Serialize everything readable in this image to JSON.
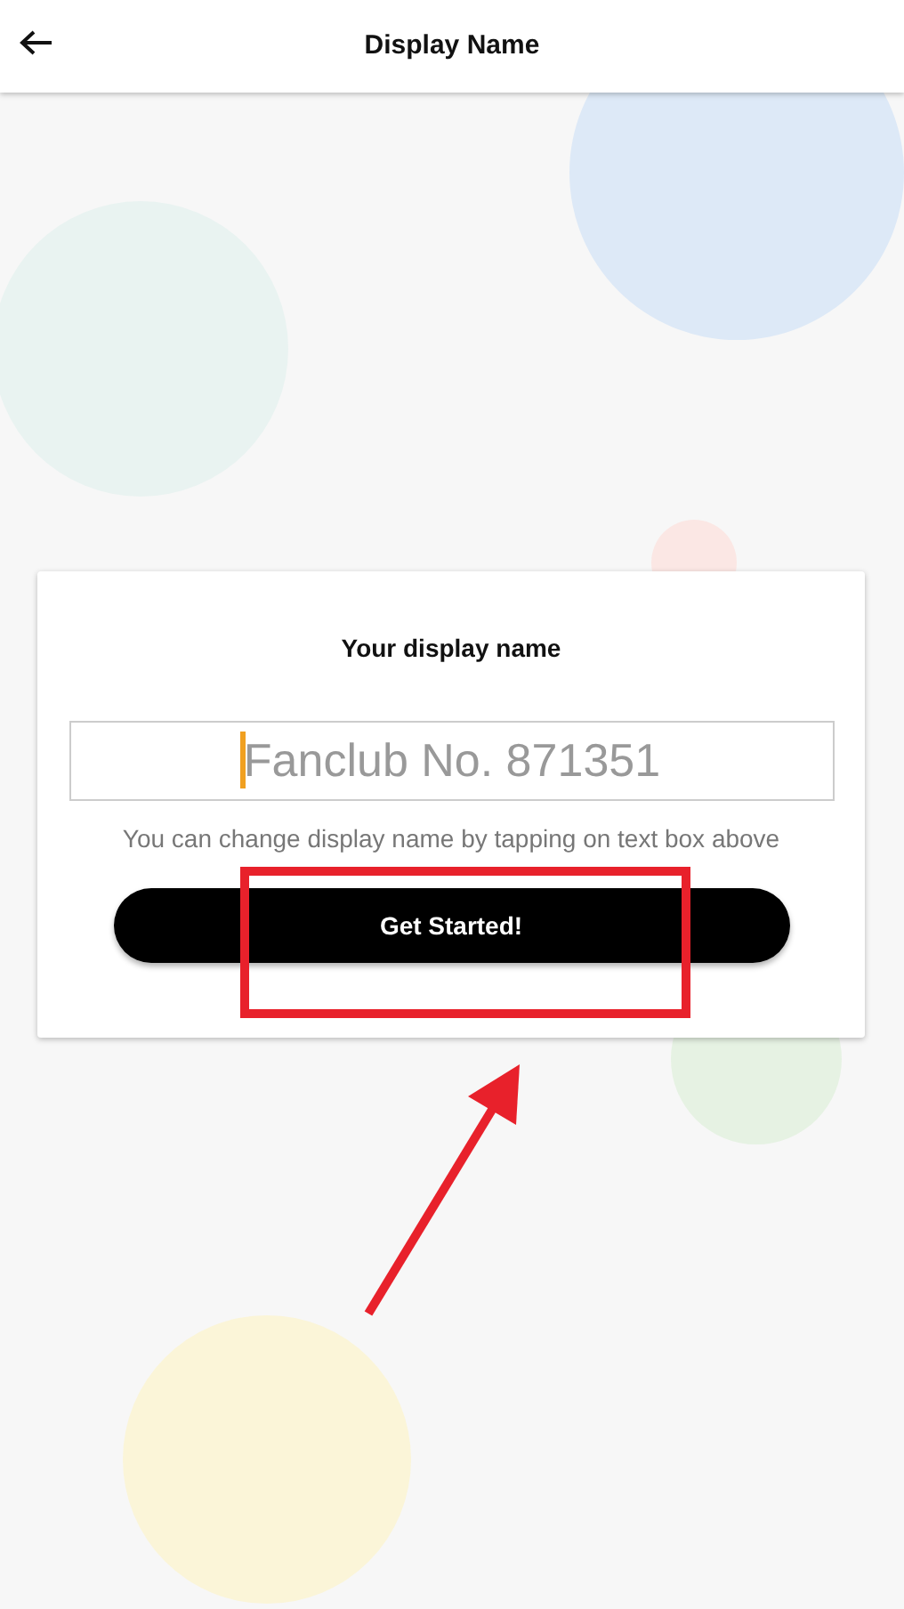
{
  "header": {
    "title": "Display Name"
  },
  "card": {
    "title": "Your display name",
    "name_field": {
      "placeholder": "Fanclub No. 871351"
    },
    "hint": "You can change display name by tapping on text box above",
    "button": "Get Started!"
  }
}
